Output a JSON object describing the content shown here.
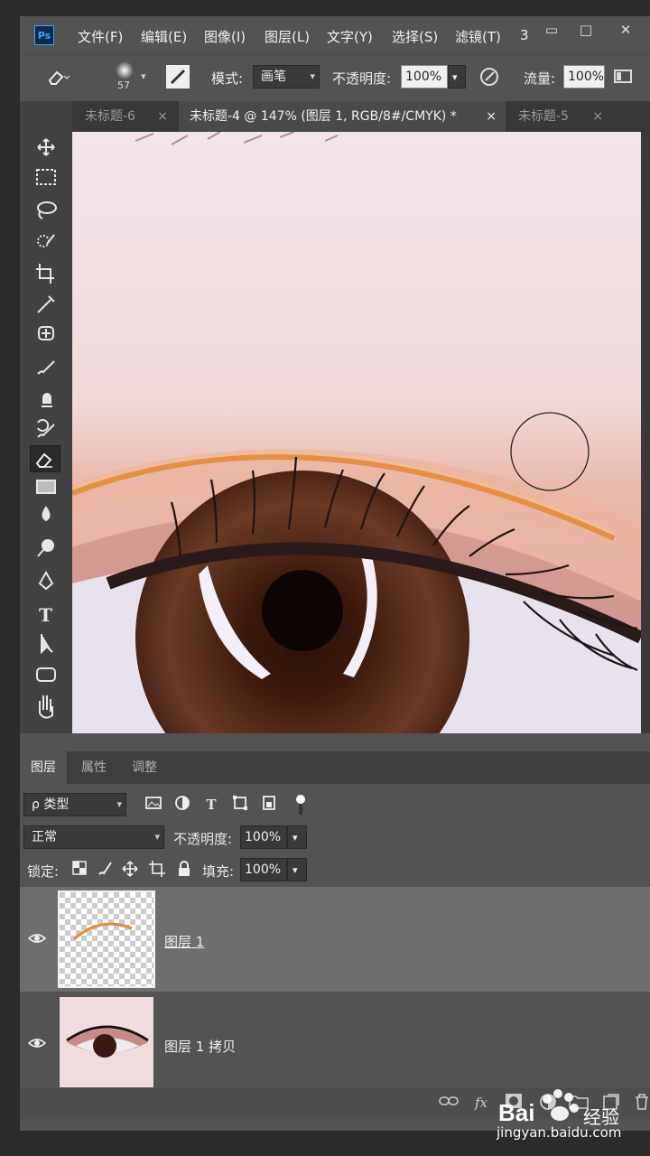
{
  "app": {
    "logo_text": "Ps"
  },
  "menu": {
    "items": [
      "文件(F)",
      "编辑(E)",
      "图像(I)",
      "图层(L)",
      "文字(Y)",
      "选择(S)",
      "滤镜(T)",
      "3"
    ]
  },
  "window_controls": {
    "minimize": "▭",
    "restore": "□",
    "close": "✕"
  },
  "options": {
    "brush_size": "57",
    "mode_label": "模式:",
    "mode_value": "画笔",
    "opacity_label": "不透明度:",
    "opacity_value": "100%",
    "flow_label": "流量:",
    "flow_value": "100%"
  },
  "tabs": [
    {
      "label": "未标题-6",
      "close": "×"
    },
    {
      "label": "未标题-4 @ 147% (图层 1, RGB/8#/CMYK) *",
      "close": "×"
    },
    {
      "label": "未标题-5",
      "close": "×"
    }
  ],
  "tools": [
    "move-icon",
    "marquee-icon",
    "lasso-icon",
    "quick-select-icon",
    "crop-icon",
    "eyedropper-icon",
    "healing-icon",
    "brush-icon",
    "stamp-icon",
    "history-brush-icon",
    "eraser-icon",
    "gradient-icon",
    "blur-icon",
    "dodge-icon",
    "pen-icon",
    "type-icon",
    "path-select-icon",
    "shape-icon",
    "hand-icon"
  ],
  "panel": {
    "tabs": [
      "图层",
      "属性",
      "调整"
    ],
    "filter_label": "ρ 类型",
    "filter_icons": [
      "image-filter-icon",
      "adjust-filter-icon",
      "type-filter-icon",
      "shape-filter-icon",
      "smart-filter-icon"
    ],
    "blend_mode": "正常",
    "opacity_label": "不透明度:",
    "opacity_value": "100%",
    "lock_label": "锁定:",
    "fill_label": "填充:",
    "fill_value": "100%",
    "layers": [
      {
        "name": "图层 1",
        "selected": true
      },
      {
        "name": "图层 1 拷贝",
        "selected": false
      }
    ],
    "bottom_icons": [
      "link-icon",
      "fx-icon",
      "mask-icon",
      "adjustment-icon",
      "group-icon",
      "new-layer-icon",
      "trash-icon"
    ],
    "bottom_fx": "fx"
  },
  "watermark": {
    "brand": "Bai",
    "brand2": "经验",
    "url": "jingyan.baidu.com"
  },
  "colors": {
    "accent": "#31a8ff",
    "ui_dark": "#535353",
    "brow_orange": "#e08c3a"
  }
}
